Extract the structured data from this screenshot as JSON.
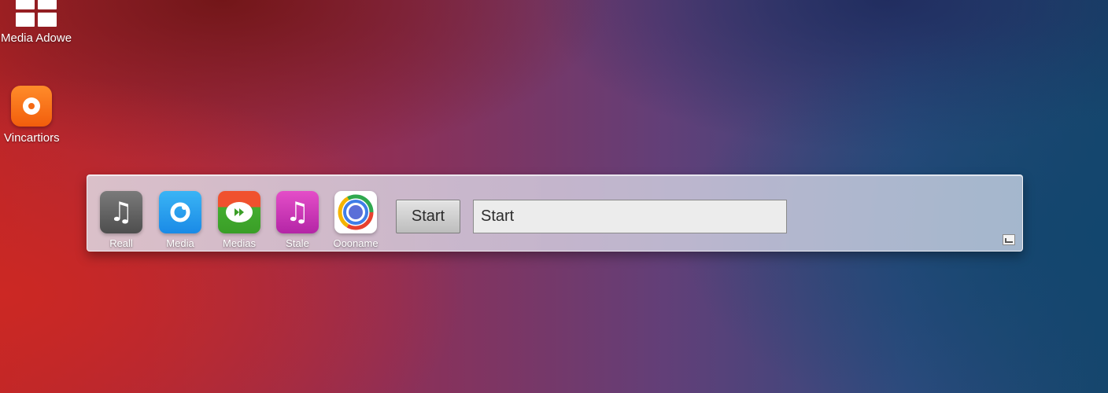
{
  "desktop": {
    "icons": [
      {
        "label": "Media Adowe",
        "icon": "windows-logo-icon"
      },
      {
        "label": "Vincartiors",
        "icon": "orange-record-app-icon"
      }
    ]
  },
  "dock": {
    "apps": [
      {
        "label": "Reall",
        "icon": "music-note-icon",
        "color": "#5e5e5e"
      },
      {
        "label": "Media",
        "icon": "media-circle-icon",
        "color": "#1f95ea"
      },
      {
        "label": "Medias",
        "icon": "play-forward-icon",
        "color": "#43ad2f"
      },
      {
        "label": "Stale",
        "icon": "music-note-icon",
        "color": "#c633b5"
      },
      {
        "label": "Oooname",
        "icon": "chrome-ring-icon",
        "color": "#ffffff"
      }
    ],
    "start_button_label": "Start",
    "start_field_value": "Start",
    "corner_icon": "show-desktop-icon"
  }
}
